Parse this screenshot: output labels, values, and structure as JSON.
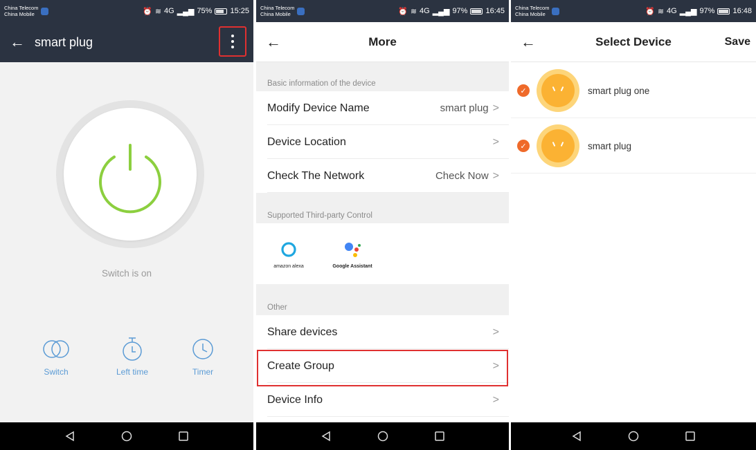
{
  "screen1": {
    "status": {
      "carrier1": "China Telecom",
      "carrier2": "China Mobile",
      "signal": "4G",
      "battery": "75%",
      "time": "15:25"
    },
    "title": "smart plug",
    "switch_text": "Switch is on",
    "controls": [
      {
        "label": "Switch",
        "icon": "switch-toggle-icon"
      },
      {
        "label": "Left time",
        "icon": "countdown-timer-icon"
      },
      {
        "label": "Timer",
        "icon": "clock-icon"
      }
    ],
    "accent_color": "#8ccf3f"
  },
  "screen2": {
    "status": {
      "carrier1": "China Telecom",
      "carrier2": "China Mobile",
      "signal": "4G",
      "battery": "97%",
      "time": "16:45"
    },
    "title": "More",
    "section1": "Basic information of the device",
    "rows1": [
      {
        "label": "Modify Device Name",
        "value": "smart plug"
      },
      {
        "label": "Device Location",
        "value": ""
      },
      {
        "label": "Check The Network",
        "value": "Check Now"
      }
    ],
    "section2": "Supported Third-party Control",
    "third_party": [
      {
        "label": "amazon alexa",
        "icon": "alexa-icon"
      },
      {
        "label": "Google Assistant",
        "icon": "google-assistant-icon"
      }
    ],
    "section3": "Other",
    "rows2": [
      {
        "label": "Share devices"
      },
      {
        "label": "Create Group"
      },
      {
        "label": "Device Info"
      }
    ]
  },
  "screen3": {
    "status": {
      "carrier1": "China Telecom",
      "carrier2": "China Mobile",
      "signal": "4G",
      "battery": "97%",
      "time": "16:48"
    },
    "title": "Select Device",
    "save": "Save",
    "devices": [
      {
        "name": "smart plug one",
        "checked": true
      },
      {
        "name": "smart plug",
        "checked": true
      }
    ],
    "check_color": "#ef6a2a"
  }
}
